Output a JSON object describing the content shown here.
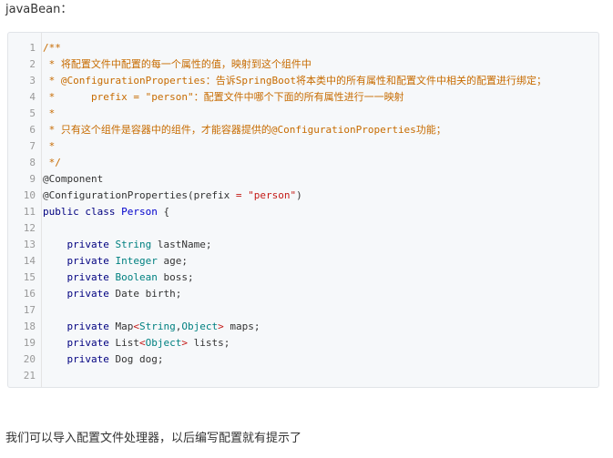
{
  "intro_text": "javaBean：",
  "outro_text": "我们可以导入配置文件处理器，以后编写配置就有提示了",
  "code": {
    "lines": [
      {
        "n": "1",
        "segments": [
          {
            "t": "/**",
            "c": "cm"
          }
        ]
      },
      {
        "n": "2",
        "segments": [
          {
            "t": " * 将配置文件中配置的每一个属性的值，映射到这个组件中",
            "c": "cm"
          }
        ]
      },
      {
        "n": "3",
        "segments": [
          {
            "t": " * @ConfigurationProperties：告诉SpringBoot将本类中的所有属性和配置文件中相关的配置进行绑定；",
            "c": "cm"
          }
        ]
      },
      {
        "n": "4",
        "segments": [
          {
            "t": " *      prefix = \"person\"：配置文件中哪个下面的所有属性进行一一映射",
            "c": "cm"
          }
        ]
      },
      {
        "n": "5",
        "segments": [
          {
            "t": " *",
            "c": "cm"
          }
        ]
      },
      {
        "n": "6",
        "segments": [
          {
            "t": " * 只有这个组件是容器中的组件，才能容器提供的@ConfigurationProperties功能；",
            "c": "cm"
          }
        ]
      },
      {
        "n": "7",
        "segments": [
          {
            "t": " *",
            "c": "cm"
          }
        ]
      },
      {
        "n": "8",
        "segments": [
          {
            "t": " */",
            "c": "cm"
          }
        ]
      },
      {
        "n": "9",
        "segments": [
          {
            "t": "@Component",
            "c": ""
          }
        ]
      },
      {
        "n": "10",
        "segments": [
          {
            "t": "@ConfigurationProperties(prefix ",
            "c": ""
          },
          {
            "t": "=",
            "c": "op"
          },
          {
            "t": " ",
            "c": ""
          },
          {
            "t": "\"person\"",
            "c": "st"
          },
          {
            "t": ")",
            "c": ""
          }
        ]
      },
      {
        "n": "11",
        "segments": [
          {
            "t": "public",
            "c": "kw"
          },
          {
            "t": " ",
            "c": ""
          },
          {
            "t": "class",
            "c": "kw"
          },
          {
            "t": " ",
            "c": ""
          },
          {
            "t": "Person",
            "c": "cl"
          },
          {
            "t": " {",
            "c": ""
          }
        ]
      },
      {
        "n": "12",
        "segments": []
      },
      {
        "n": "13",
        "segments": [
          {
            "t": "    ",
            "c": ""
          },
          {
            "t": "private",
            "c": "kw"
          },
          {
            "t": " ",
            "c": ""
          },
          {
            "t": "String",
            "c": "ty"
          },
          {
            "t": " lastName;",
            "c": ""
          }
        ]
      },
      {
        "n": "14",
        "segments": [
          {
            "t": "    ",
            "c": ""
          },
          {
            "t": "private",
            "c": "kw"
          },
          {
            "t": " ",
            "c": ""
          },
          {
            "t": "Integer",
            "c": "ty"
          },
          {
            "t": " age;",
            "c": ""
          }
        ]
      },
      {
        "n": "15",
        "segments": [
          {
            "t": "    ",
            "c": ""
          },
          {
            "t": "private",
            "c": "kw"
          },
          {
            "t": " ",
            "c": ""
          },
          {
            "t": "Boolean",
            "c": "ty"
          },
          {
            "t": " boss;",
            "c": ""
          }
        ]
      },
      {
        "n": "16",
        "segments": [
          {
            "t": "    ",
            "c": ""
          },
          {
            "t": "private",
            "c": "kw"
          },
          {
            "t": " Date birth;",
            "c": ""
          }
        ]
      },
      {
        "n": "17",
        "segments": []
      },
      {
        "n": "18",
        "segments": [
          {
            "t": "    ",
            "c": ""
          },
          {
            "t": "private",
            "c": "kw"
          },
          {
            "t": " Map",
            "c": ""
          },
          {
            "t": "<",
            "c": "op"
          },
          {
            "t": "String",
            "c": "ty"
          },
          {
            "t": ",",
            "c": ""
          },
          {
            "t": "Object",
            "c": "ty"
          },
          {
            "t": ">",
            "c": "op"
          },
          {
            "t": " maps;",
            "c": ""
          }
        ]
      },
      {
        "n": "19",
        "segments": [
          {
            "t": "    ",
            "c": ""
          },
          {
            "t": "private",
            "c": "kw"
          },
          {
            "t": " List",
            "c": ""
          },
          {
            "t": "<",
            "c": "op"
          },
          {
            "t": "Object",
            "c": "ty"
          },
          {
            "t": ">",
            "c": "op"
          },
          {
            "t": " lists;",
            "c": ""
          }
        ]
      },
      {
        "n": "20",
        "segments": [
          {
            "t": "    ",
            "c": ""
          },
          {
            "t": "private",
            "c": "kw"
          },
          {
            "t": " Dog dog;",
            "c": ""
          }
        ]
      },
      {
        "n": "21",
        "segments": []
      }
    ]
  }
}
